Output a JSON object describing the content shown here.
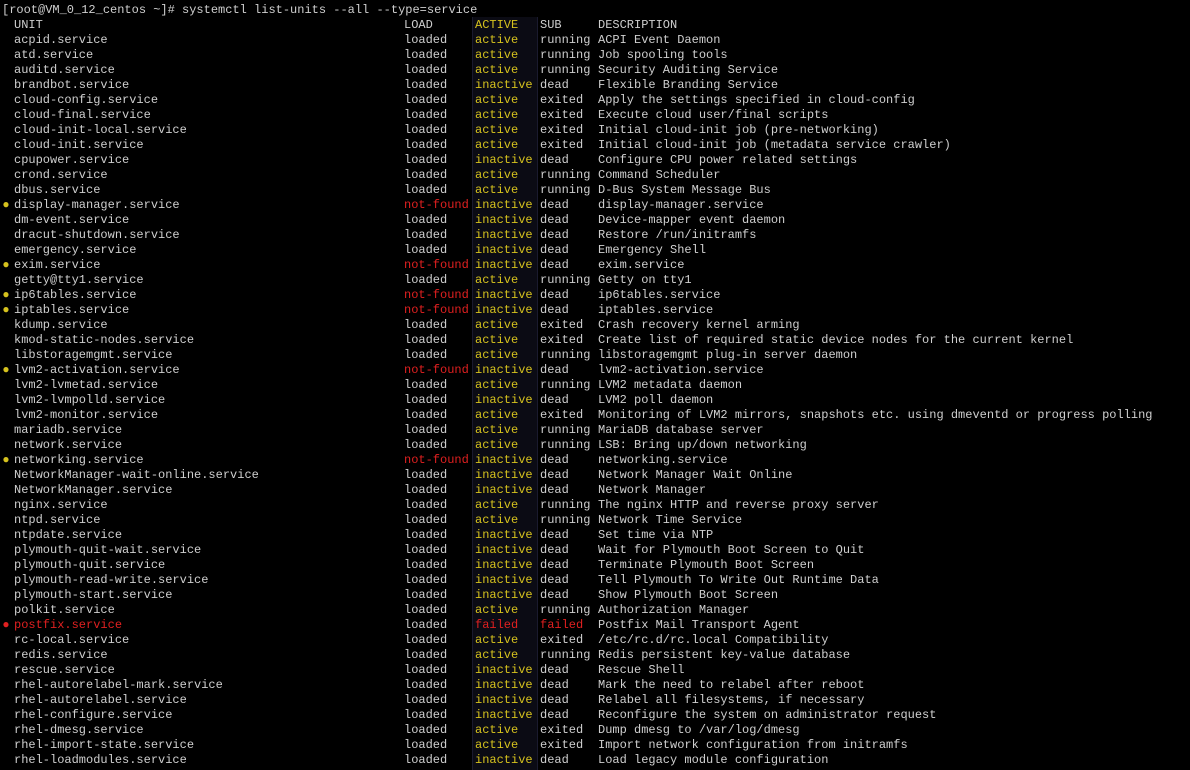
{
  "terminal": {
    "prompt": "[root@VM_0_12_centos ~]# systemctl list-units --all --type=service",
    "headers": {
      "unit": "UNIT",
      "load": "LOAD",
      "active": "ACTIVE",
      "sub": "SUB",
      "description": "DESCRIPTION"
    },
    "colors": {
      "text": "#cfcfcf",
      "active_ok": "#d6c21e",
      "not_found": "#e02020",
      "failed": "#e02020",
      "bullet_warn": "#d6c21e",
      "bullet_fail": "#e02020",
      "background": "#000000"
    },
    "rows": [
      {
        "bullet": "",
        "unit": "acpid.service",
        "load": "loaded",
        "active": "active",
        "sub": "running",
        "description": "ACPI Event Daemon"
      },
      {
        "bullet": "",
        "unit": "atd.service",
        "load": "loaded",
        "active": "active",
        "sub": "running",
        "description": "Job spooling tools"
      },
      {
        "bullet": "",
        "unit": "auditd.service",
        "load": "loaded",
        "active": "active",
        "sub": "running",
        "description": "Security Auditing Service"
      },
      {
        "bullet": "",
        "unit": "brandbot.service",
        "load": "loaded",
        "active": "inactive",
        "sub": "dead",
        "description": "Flexible Branding Service"
      },
      {
        "bullet": "",
        "unit": "cloud-config.service",
        "load": "loaded",
        "active": "active",
        "sub": "exited",
        "description": "Apply the settings specified in cloud-config"
      },
      {
        "bullet": "",
        "unit": "cloud-final.service",
        "load": "loaded",
        "active": "active",
        "sub": "exited",
        "description": "Execute cloud user/final scripts"
      },
      {
        "bullet": "",
        "unit": "cloud-init-local.service",
        "load": "loaded",
        "active": "active",
        "sub": "exited",
        "description": "Initial cloud-init job (pre-networking)"
      },
      {
        "bullet": "",
        "unit": "cloud-init.service",
        "load": "loaded",
        "active": "active",
        "sub": "exited",
        "description": "Initial cloud-init job (metadata service crawler)"
      },
      {
        "bullet": "",
        "unit": "cpupower.service",
        "load": "loaded",
        "active": "inactive",
        "sub": "dead",
        "description": "Configure CPU power related settings"
      },
      {
        "bullet": "",
        "unit": "crond.service",
        "load": "loaded",
        "active": "active",
        "sub": "running",
        "description": "Command Scheduler"
      },
      {
        "bullet": "",
        "unit": "dbus.service",
        "load": "loaded",
        "active": "active",
        "sub": "running",
        "description": "D-Bus System Message Bus"
      },
      {
        "bullet": "●",
        "unit": "display-manager.service",
        "load": "not-found",
        "active": "inactive",
        "sub": "dead",
        "description": "display-manager.service"
      },
      {
        "bullet": "",
        "unit": "dm-event.service",
        "load": "loaded",
        "active": "inactive",
        "sub": "dead",
        "description": "Device-mapper event daemon"
      },
      {
        "bullet": "",
        "unit": "dracut-shutdown.service",
        "load": "loaded",
        "active": "inactive",
        "sub": "dead",
        "description": "Restore /run/initramfs"
      },
      {
        "bullet": "",
        "unit": "emergency.service",
        "load": "loaded",
        "active": "inactive",
        "sub": "dead",
        "description": "Emergency Shell"
      },
      {
        "bullet": "●",
        "unit": "exim.service",
        "load": "not-found",
        "active": "inactive",
        "sub": "dead",
        "description": "exim.service"
      },
      {
        "bullet": "",
        "unit": "getty@tty1.service",
        "load": "loaded",
        "active": "active",
        "sub": "running",
        "description": "Getty on tty1"
      },
      {
        "bullet": "●",
        "unit": "ip6tables.service",
        "load": "not-found",
        "active": "inactive",
        "sub": "dead",
        "description": "ip6tables.service"
      },
      {
        "bullet": "●",
        "unit": "iptables.service",
        "load": "not-found",
        "active": "inactive",
        "sub": "dead",
        "description": "iptables.service"
      },
      {
        "bullet": "",
        "unit": "kdump.service",
        "load": "loaded",
        "active": "active",
        "sub": "exited",
        "description": "Crash recovery kernel arming"
      },
      {
        "bullet": "",
        "unit": "kmod-static-nodes.service",
        "load": "loaded",
        "active": "active",
        "sub": "exited",
        "description": "Create list of required static device nodes for the current kernel"
      },
      {
        "bullet": "",
        "unit": "libstoragemgmt.service",
        "load": "loaded",
        "active": "active",
        "sub": "running",
        "description": "libstoragemgmt plug-in server daemon"
      },
      {
        "bullet": "●",
        "unit": "lvm2-activation.service",
        "load": "not-found",
        "active": "inactive",
        "sub": "dead",
        "description": "lvm2-activation.service"
      },
      {
        "bullet": "",
        "unit": "lvm2-lvmetad.service",
        "load": "loaded",
        "active": "active",
        "sub": "running",
        "description": "LVM2 metadata daemon"
      },
      {
        "bullet": "",
        "unit": "lvm2-lvmpolld.service",
        "load": "loaded",
        "active": "inactive",
        "sub": "dead",
        "description": "LVM2 poll daemon"
      },
      {
        "bullet": "",
        "unit": "lvm2-monitor.service",
        "load": "loaded",
        "active": "active",
        "sub": "exited",
        "description": "Monitoring of LVM2 mirrors, snapshots etc. using dmeventd or progress polling"
      },
      {
        "bullet": "",
        "unit": "mariadb.service",
        "load": "loaded",
        "active": "active",
        "sub": "running",
        "description": "MariaDB database server"
      },
      {
        "bullet": "",
        "unit": "network.service",
        "load": "loaded",
        "active": "active",
        "sub": "running",
        "description": "LSB: Bring up/down networking"
      },
      {
        "bullet": "●",
        "unit": "networking.service",
        "load": "not-found",
        "active": "inactive",
        "sub": "dead",
        "description": "networking.service"
      },
      {
        "bullet": "",
        "unit": "NetworkManager-wait-online.service",
        "load": "loaded",
        "active": "inactive",
        "sub": "dead",
        "description": "Network Manager Wait Online"
      },
      {
        "bullet": "",
        "unit": "NetworkManager.service",
        "load": "loaded",
        "active": "inactive",
        "sub": "dead",
        "description": "Network Manager"
      },
      {
        "bullet": "",
        "unit": "nginx.service",
        "load": "loaded",
        "active": "active",
        "sub": "running",
        "description": "The nginx HTTP and reverse proxy server"
      },
      {
        "bullet": "",
        "unit": "ntpd.service",
        "load": "loaded",
        "active": "active",
        "sub": "running",
        "description": "Network Time Service"
      },
      {
        "bullet": "",
        "unit": "ntpdate.service",
        "load": "loaded",
        "active": "inactive",
        "sub": "dead",
        "description": "Set time via NTP"
      },
      {
        "bullet": "",
        "unit": "plymouth-quit-wait.service",
        "load": "loaded",
        "active": "inactive",
        "sub": "dead",
        "description": "Wait for Plymouth Boot Screen to Quit"
      },
      {
        "bullet": "",
        "unit": "plymouth-quit.service",
        "load": "loaded",
        "active": "inactive",
        "sub": "dead",
        "description": "Terminate Plymouth Boot Screen"
      },
      {
        "bullet": "",
        "unit": "plymouth-read-write.service",
        "load": "loaded",
        "active": "inactive",
        "sub": "dead",
        "description": "Tell Plymouth To Write Out Runtime Data"
      },
      {
        "bullet": "",
        "unit": "plymouth-start.service",
        "load": "loaded",
        "active": "inactive",
        "sub": "dead",
        "description": "Show Plymouth Boot Screen"
      },
      {
        "bullet": "",
        "unit": "polkit.service",
        "load": "loaded",
        "active": "active",
        "sub": "running",
        "description": "Authorization Manager"
      },
      {
        "bullet": "●",
        "unit": "postfix.service",
        "load": "loaded",
        "active": "failed",
        "sub": "failed",
        "description": "Postfix Mail Transport Agent",
        "failed": true
      },
      {
        "bullet": "",
        "unit": "rc-local.service",
        "load": "loaded",
        "active": "active",
        "sub": "exited",
        "description": "/etc/rc.d/rc.local Compatibility"
      },
      {
        "bullet": "",
        "unit": "redis.service",
        "load": "loaded",
        "active": "active",
        "sub": "running",
        "description": "Redis persistent key-value database"
      },
      {
        "bullet": "",
        "unit": "rescue.service",
        "load": "loaded",
        "active": "inactive",
        "sub": "dead",
        "description": "Rescue Shell"
      },
      {
        "bullet": "",
        "unit": "rhel-autorelabel-mark.service",
        "load": "loaded",
        "active": "inactive",
        "sub": "dead",
        "description": "Mark the need to relabel after reboot"
      },
      {
        "bullet": "",
        "unit": "rhel-autorelabel.service",
        "load": "loaded",
        "active": "inactive",
        "sub": "dead",
        "description": "Relabel all filesystems, if necessary"
      },
      {
        "bullet": "",
        "unit": "rhel-configure.service",
        "load": "loaded",
        "active": "inactive",
        "sub": "dead",
        "description": "Reconfigure the system on administrator request"
      },
      {
        "bullet": "",
        "unit": "rhel-dmesg.service",
        "load": "loaded",
        "active": "active",
        "sub": "exited",
        "description": "Dump dmesg to /var/log/dmesg"
      },
      {
        "bullet": "",
        "unit": "rhel-import-state.service",
        "load": "loaded",
        "active": "active",
        "sub": "exited",
        "description": "Import network configuration from initramfs"
      },
      {
        "bullet": "",
        "unit": "rhel-loadmodules.service",
        "load": "loaded",
        "active": "inactive",
        "sub": "dead",
        "description": "Load legacy module configuration"
      }
    ]
  }
}
